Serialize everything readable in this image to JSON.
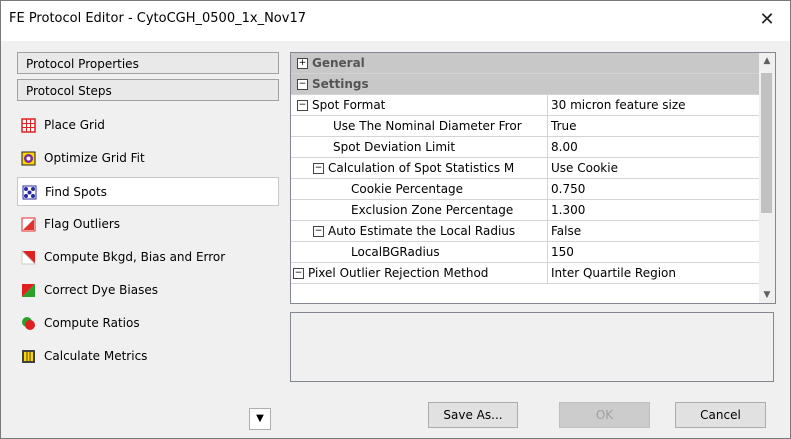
{
  "window": {
    "title": "FE Protocol Editor - CytoCGH_0500_1x_Nov17",
    "close_glyph": "✕"
  },
  "left": {
    "protocol_properties": "Protocol Properties",
    "protocol_steps": "Protocol Steps",
    "steps": [
      {
        "label": "Place Grid",
        "icon": "grid-icon",
        "color": "#e02020"
      },
      {
        "label": "Optimize Grid Fit",
        "icon": "optimize-icon",
        "color": "#7a2a9a"
      },
      {
        "label": "Find Spots",
        "icon": "find-spots-icon",
        "color": "#2a2aa0"
      },
      {
        "label": "Flag Outliers",
        "icon": "flag-outliers-icon",
        "color": "#e03030"
      },
      {
        "label": "Compute Bkgd, Bias and Error",
        "icon": "bkgd-icon",
        "color": "#e02020"
      },
      {
        "label": "Correct Dye Biases",
        "icon": "dye-icon",
        "color": "#2aa02a"
      },
      {
        "label": "Compute Ratios",
        "icon": "ratios-icon",
        "color": "#e02020"
      },
      {
        "label": "Calculate Metrics",
        "icon": "metrics-icon",
        "color": "#404040"
      }
    ],
    "selected_step": "Find Spots",
    "scroll_glyph": "▼"
  },
  "grid": {
    "expander_plus": "+",
    "expander_minus": "−",
    "rows": [
      {
        "name": "General",
        "value": "",
        "type": "category"
      },
      {
        "name": "Settings",
        "value": "",
        "type": "category"
      },
      {
        "name": "Spot Format",
        "value": "30 micron feature size"
      },
      {
        "name": "Use The Nominal Diameter Fror",
        "value": "True"
      },
      {
        "name": "Spot Deviation Limit",
        "value": "8.00"
      },
      {
        "name": "Calculation of Spot Statistics M",
        "value": "Use Cookie"
      },
      {
        "name": "Cookie Percentage",
        "value": "0.750"
      },
      {
        "name": "Exclusion Zone Percentage",
        "value": "1.300"
      },
      {
        "name": "Auto Estimate the Local Radius",
        "value": "False"
      },
      {
        "name": "LocalBGRadius",
        "value": "150"
      },
      {
        "name": "Pixel Outlier Rejection Method",
        "value": "Inter Quartile Region"
      }
    ],
    "scroll_up": "▲",
    "scroll_down": "▼"
  },
  "buttons": {
    "save_as": "Save As...",
    "ok": "OK",
    "cancel": "Cancel"
  }
}
